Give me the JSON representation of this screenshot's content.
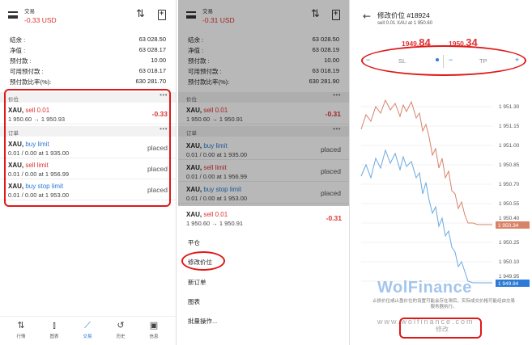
{
  "panel1": {
    "title": "交易",
    "pnl": "-0.33 USD",
    "account": [
      {
        "label": "结余 :",
        "value": "63 028.50"
      },
      {
        "label": "净值 :",
        "value": "63 028.17"
      },
      {
        "label": "预付款 :",
        "value": "10.00"
      },
      {
        "label": "可用预付款 :",
        "value": "63 018.17"
      },
      {
        "label": "预付款比率(%):",
        "value": "630 281.70"
      }
    ],
    "positions_header": "价位",
    "position": {
      "symbol": "XAU,",
      "action": "sell 0.01",
      "detail": "1 950.60 → 1 950.93",
      "result": "-0.33"
    },
    "orders_header": "订单",
    "orders": [
      {
        "symbol": "XAU,",
        "action": "buy limit",
        "action_color": "blue",
        "detail": "0.01 / 0.00 at 1 935.00",
        "status": "placed"
      },
      {
        "symbol": "XAU,",
        "action": "sell limit",
        "action_color": "red",
        "detail": "0.01 / 0.00 at 1 956.99",
        "status": "placed"
      },
      {
        "symbol": "XAU,",
        "action": "buy stop limit",
        "action_color": "blue",
        "detail": "0.01 / 0.00 at 1 953.00",
        "status": "placed"
      }
    ],
    "nav": [
      {
        "label": "行情",
        "icon": "swap-arrows-icon",
        "glyph": "⇅"
      },
      {
        "label": "图表",
        "icon": "candles-icon",
        "glyph": "⫾"
      },
      {
        "label": "交易",
        "icon": "trend-line-icon",
        "glyph": "⟋"
      },
      {
        "label": "历史",
        "icon": "history-icon",
        "glyph": "↺"
      },
      {
        "label": "信息",
        "icon": "chat-icon",
        "glyph": "▣"
      }
    ]
  },
  "panel2": {
    "title": "交易",
    "pnl": "-0.31 USD",
    "account": [
      {
        "label": "结余 :",
        "value": "63 028.50"
      },
      {
        "label": "净值 :",
        "value": "63 028.19"
      },
      {
        "label": "预付款 :",
        "value": "10.00"
      },
      {
        "label": "可用预付款 :",
        "value": "63 018.19"
      },
      {
        "label": "预付款比率(%):",
        "value": "630 281.90"
      }
    ],
    "positions_header": "价位",
    "position": {
      "symbol": "XAU,",
      "action": "sell 0.01",
      "detail": "1 950.60 → 1 950.91",
      "result": "-0.31"
    },
    "orders_header": "订单",
    "orders": [
      {
        "symbol": "XAU,",
        "action": "buy limit",
        "action_color": "blue",
        "detail": "0.01 / 0.00 at 1 935.00",
        "status": "placed"
      },
      {
        "symbol": "XAU,",
        "action": "sell limit",
        "action_color": "red",
        "detail": "0.01 / 0.00 at 1 956.99",
        "status": "placed"
      },
      {
        "symbol": "XAU,",
        "action": "buy stop limit",
        "action_color": "blue",
        "detail": "0.01 / 0.00 at 1 953.00",
        "status": "placed"
      }
    ],
    "selected": {
      "symbol": "XAU,",
      "action": "sell 0.01",
      "detail": "1 950.60 → 1 950.91",
      "result": "-0.31"
    },
    "menu": [
      "平仓",
      "修改价位",
      "新订单",
      "图表",
      "批量操作..."
    ]
  },
  "panel3": {
    "title": "修改价位 #18924",
    "subtitle": "sell 0.01 XAU at 1 950.60",
    "bid_main": "1949.",
    "bid_big": "84",
    "ask_main": "1950.",
    "ask_big": "34",
    "sl_label": "SL",
    "tp_label": "TP",
    "minus": "−",
    "plus": "+",
    "y_ticks": [
      "1 951.30",
      "1 951.15",
      "1 951.00",
      "1 950.85",
      "1 950.70",
      "1 950.55",
      "1 950.40",
      "1 950.25",
      "1 950.10",
      "1 949.95"
    ],
    "tag_ask": "1 950.34",
    "tag_bid": "1 949.84",
    "disclaimer": "止损价位或止盈价位的设置可能会存在滞后，实际成交价格可能经由交易服务器执行。",
    "modify_label": "修改",
    "watermark": "WolFinance",
    "watermark_url": "www.wolfinance.com"
  },
  "colors": {
    "accent": "#2a7ad6",
    "loss": "#d33333",
    "annotation": "#e01818",
    "ask_line": "#d9826a",
    "bid_line": "#6aa9e0"
  }
}
